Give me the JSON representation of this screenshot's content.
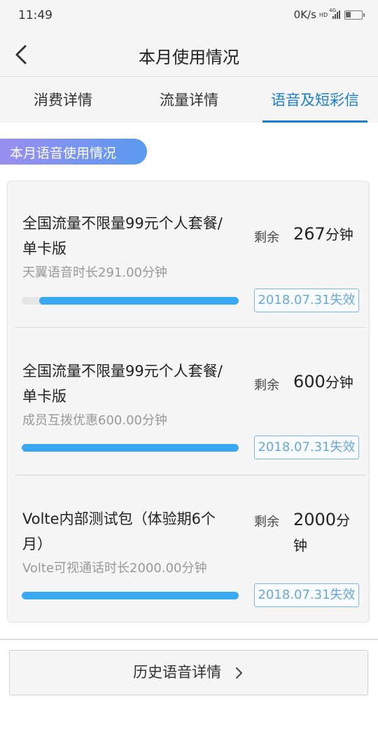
{
  "status_bar": {
    "time": "11:49",
    "net_speed": "0K/s",
    "hd": "HD",
    "network": "4G",
    "battery_level": 0.3
  },
  "header": {
    "back_icon": "chevron-left-icon",
    "title": "本月使用情况"
  },
  "tabs": [
    {
      "label": "消费详情",
      "active": false
    },
    {
      "label": "流量详情",
      "active": false
    },
    {
      "label": "语音及短彩信",
      "active": true
    }
  ],
  "section_title": "本月语音使用情况",
  "packages": [
    {
      "name": "全国流量不限量99元个人套餐/单卡版",
      "desc": "天翼语音时长291.00分钟",
      "remain_label": "剩余",
      "remain_value": "267",
      "remain_unit": "分钟",
      "progress_fraction": 0.92,
      "expire": "2018.07.31失效"
    },
    {
      "name": "全国流量不限量99元个人套餐/单卡版",
      "desc": "成员互拨优惠600.00分钟",
      "remain_label": "剩余",
      "remain_value": "600",
      "remain_unit": "分钟",
      "progress_fraction": 1.0,
      "expire": "2018.07.31失效"
    },
    {
      "name": "Volte内部测试包（体验期6个月）",
      "desc": "Volte可视通话时长2000.00分钟",
      "remain_label": "剩余",
      "remain_value": "2000",
      "remain_unit": "分钟",
      "progress_fraction": 1.0,
      "expire": "2018.07.31失效"
    }
  ],
  "history_button": {
    "label": "历史语音详情",
    "icon": "chevron-right-icon"
  },
  "colors": {
    "accent": "#1a7fd0",
    "progress": "#3aa8f0",
    "tag_start": "#9a8ef0",
    "tag_end": "#5a9af0"
  }
}
